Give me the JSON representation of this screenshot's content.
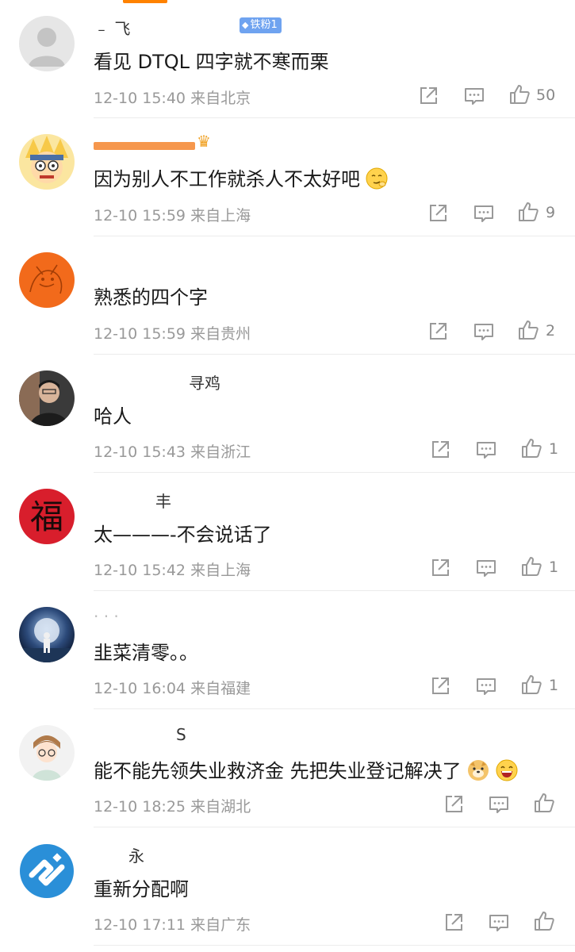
{
  "comments": [
    {
      "username": "﹣ 飞",
      "badge": "铁粉1",
      "text": "看见 DTQL 四字就不寒而栗",
      "time": "12-10 15:40",
      "location": "来自北京",
      "likes": "50"
    },
    {
      "username": "",
      "text": "因为别人不工作就杀人不太好吧",
      "time": "12-10 15:59",
      "location": "来自上海",
      "likes": "9"
    },
    {
      "username": "",
      "text": "熟悉的四个字",
      "time": "12-10 15:59",
      "location": "来自贵州",
      "likes": "2"
    },
    {
      "username": "寻鸡",
      "text": "哈人",
      "time": "12-10 15:43",
      "location": "来自浙江",
      "likes": "1"
    },
    {
      "username": "丰",
      "text": "太———-不会说话了",
      "time": "12-10 15:42",
      "location": "来自上海",
      "likes": "1"
    },
    {
      "username": "· · ·",
      "text": "韭菜清零。。",
      "time": "12-10 16:04",
      "location": "来自福建",
      "likes": "1"
    },
    {
      "username": "S",
      "text": "能不能先领失业救济金 先把失业登记解决了",
      "time": "12-10 18:25",
      "location": "来自湖北",
      "likes": ""
    },
    {
      "username": "永",
      "text": "重新分配啊",
      "time": "12-10 17:11",
      "location": "来自广东",
      "likes": ""
    }
  ],
  "colors": {
    "accent": "#ff8200",
    "meta_gray": "#999999",
    "badge_blue": "#6fa3f0"
  },
  "icons": [
    "forward-icon",
    "comment-icon",
    "like-icon",
    "crown-icon",
    "smirk-emoji-icon",
    "doge-emoji-icon",
    "laugh-emoji-icon"
  ]
}
